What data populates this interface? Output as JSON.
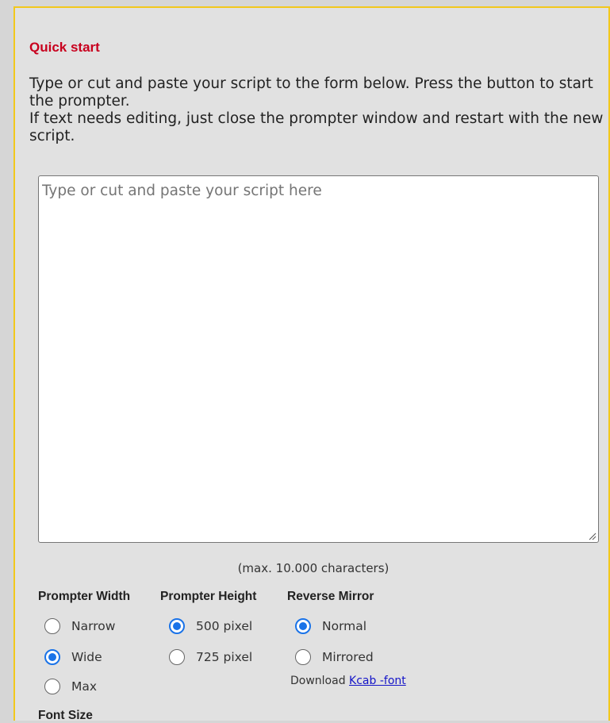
{
  "quick_start": {
    "title": "Quick start",
    "intro_line1": "Type or cut and paste your script to the form below. Press the button to start the prompter.",
    "intro_line2": "If text needs editing, just close the prompter window and restart with the new script."
  },
  "script": {
    "placeholder": "Type or cut and paste your script here",
    "value": "",
    "max_note": "(max. 10.000 characters)"
  },
  "options": {
    "prompter_width": {
      "label": "Prompter Width",
      "choices": [
        {
          "label": "Narrow",
          "checked": false
        },
        {
          "label": "Wide",
          "checked": true
        },
        {
          "label": "Max",
          "checked": false
        }
      ]
    },
    "prompter_height": {
      "label": "Prompter Height",
      "choices": [
        {
          "label": "500 pixel",
          "checked": true
        },
        {
          "label": "725 pixel",
          "checked": false
        }
      ]
    },
    "reverse_mirror": {
      "label": "Reverse Mirror",
      "choices": [
        {
          "label": "Normal",
          "checked": true
        },
        {
          "label": "Mirrored",
          "checked": false
        }
      ]
    },
    "download_prefix": "Download",
    "download_link": "Kcab -font",
    "font_size_label": "Font Size"
  },
  "colors": {
    "title_red": "#c8001e",
    "panel_border": "#f2c81c",
    "radio_blue": "#1a73e8",
    "link_blue": "#1515c8"
  }
}
